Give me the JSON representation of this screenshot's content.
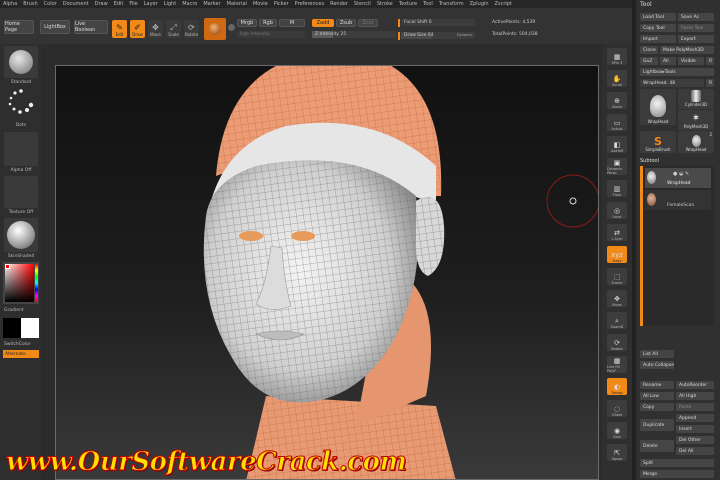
{
  "menu": [
    "Alpha",
    "Brush",
    "Color",
    "Document",
    "Draw",
    "Edit",
    "File",
    "Layer",
    "Light",
    "Macro",
    "Marker",
    "Material",
    "Movie",
    "Picker",
    "Preferences",
    "Render",
    "Stencil",
    "Stroke",
    "Texture",
    "Tool",
    "Transform",
    "Zplugin",
    "Zscript"
  ],
  "toolbar": {
    "home_page": "Home Page",
    "lightbox": "LightBox",
    "live_boolean": "Live Boolean",
    "edit": "Edit",
    "draw": "Draw",
    "move": "Move",
    "scale": "Scale",
    "rotate": "Rotate",
    "mrgb": "Mrgb",
    "rgb": "Rgb",
    "m": "M",
    "rgb_intensity": "Rgb Intensity",
    "zadd": "Zadd",
    "zsub": "Zsub",
    "zcut": "Zcut",
    "z_intensity": "Z Intensity 25",
    "focal_shift": "Focal Shift 0",
    "draw_size": "Draw Size 64",
    "dynamic": "Dynamic",
    "active_points": "ActivePoints: 4,539",
    "total_points": "TotalPoints: 504,038",
    "accent": "#f28a1a"
  },
  "left_shelf": {
    "standard": "Standard",
    "dots": "Dots",
    "alpha_off": "Alpha Off",
    "texture_off": "Texture Off",
    "material": "SkinShade4",
    "gradient": "Gradient",
    "switch_color": "SwitchColor",
    "alternate": "Alternate"
  },
  "right_shelf": [
    "SPix 3",
    "Scroll",
    "Zoom",
    "Actual",
    "AAHalf",
    "Dynamic Persp",
    "Floor",
    "Local",
    "L.Sym",
    "Gxyz",
    "Frame",
    "Move",
    "ZoomD",
    "Rotate",
    "Line Fill PolyF",
    "Transp",
    "Ghost",
    "Solo",
    "Xpose"
  ],
  "tool_panel": {
    "title": "Tool",
    "load_tool": "Load Tool",
    "save_as": "Save As",
    "copy_tool": "Copy Tool",
    "paste_tool": "Paste Tool",
    "import": "Import",
    "export": "Export",
    "clone": "Clone",
    "make_polymesh": "Make PolyMesh3D",
    "goz": "GoZ",
    "all": "All",
    "visible": "Visible",
    "r": "R",
    "lightbox_tools": "Lightbox▸Tools",
    "current_tool": "WrapHead. 48",
    "thumbs": [
      {
        "label": "WrapHead",
        "badge": ""
      },
      {
        "label": "Cylinder3D",
        "badge": ""
      },
      {
        "label": "PolyMesh3D",
        "badge": ""
      },
      {
        "label": "SimpleBrush",
        "badge": ""
      },
      {
        "label": "WrapHead",
        "badge": "2"
      }
    ],
    "subtool": "Subtool",
    "subtools": [
      "WrapHead",
      "FemaleScan"
    ],
    "list_all": "List All",
    "auto_collapse": "Auto Collapse",
    "rename": "Rename",
    "auto_reorder": "AutoReorder",
    "all_low": "All Low",
    "all_high": "All High",
    "copy": "Copy",
    "paste": "Paste",
    "duplicate": "Duplicate",
    "append": "Append",
    "insert": "Insert",
    "delete": "Delete",
    "del_other": "Del Other",
    "del_all": "Del All",
    "split": "Split",
    "merge": "Merge"
  },
  "watermark": "www.OurSoftwareCrack.com"
}
